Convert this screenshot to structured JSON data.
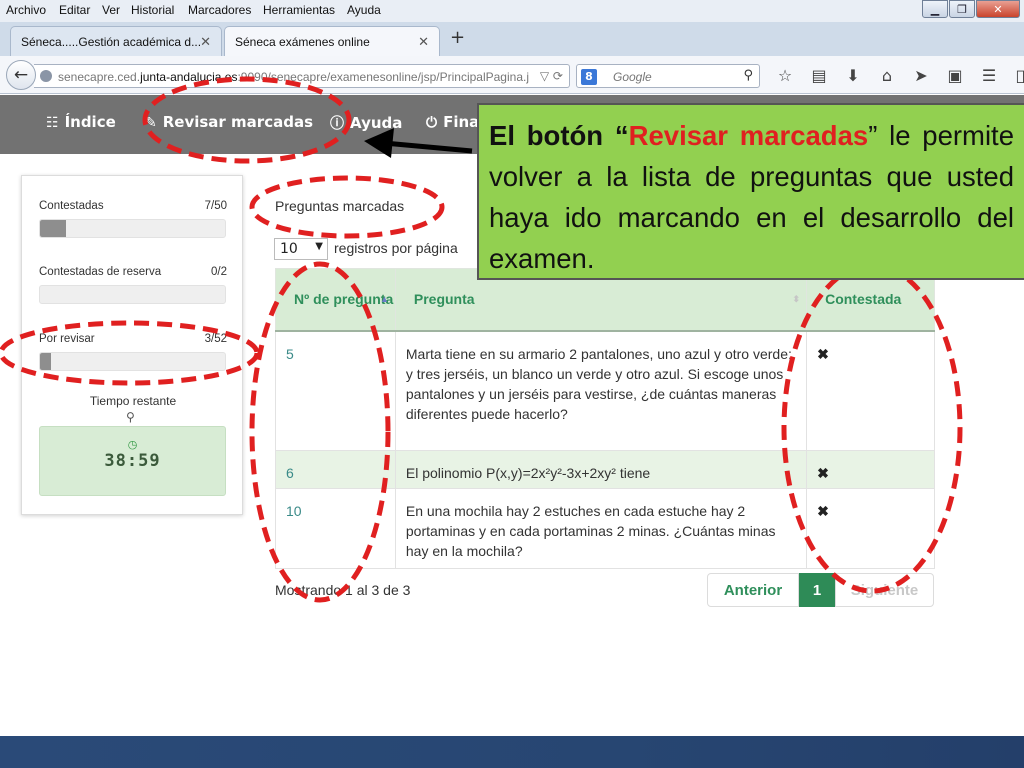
{
  "browser": {
    "menu": [
      "Archivo",
      "Editar",
      "Ver",
      "Historial",
      "Marcadores",
      "Herramientas",
      "Ayuda"
    ],
    "tabs": [
      {
        "label": "Séneca.....Gestión académica d..."
      },
      {
        "label": "Séneca exámenes online"
      }
    ],
    "url_pre": "senecapre.ced.",
    "url_host": "junta-andalucia.es",
    "url_post": ":9090/senecapre/examenesonline/jsp/PrincipalPagina.j",
    "search_placeholder": "Google"
  },
  "appnav": {
    "indice": "Índice",
    "revisar": "Revisar marcadas",
    "ayuda": "Ayuda",
    "finalizar": "Fina"
  },
  "sidebar": {
    "contestadas_label": "Contestadas",
    "contestadas_value": "7/50",
    "contestadas_fraction": 0.14,
    "reserva_label": "Contestadas de reserva",
    "reserva_value": "0/2",
    "reserva_fraction": 0,
    "revisar_label": "Por revisar",
    "revisar_value": "3/52",
    "revisar_fraction": 0.058,
    "tiempo_label": "Tiempo restante",
    "tiempo_value": "38:59"
  },
  "main": {
    "title": "Preguntas marcadas",
    "page_size": "10",
    "per_page_label": "registros por página",
    "columns": [
      "Nº de pregunta",
      "Pregunta",
      "Contestada"
    ],
    "rows": [
      {
        "num": "5",
        "text": "Marta tiene en su armario 2 pantalones, uno azul y otro verde; y tres jerséis, un blanco un verde y otro azul. Si escoge unos pantalones y un jerséis para vestirse, ¿de cuántas maneras diferentes puede hacerlo?",
        "answered": "✖"
      },
      {
        "num": "6",
        "text": "El polinomio P(x,y)=2x²y²-3x+2xy² tiene",
        "answered": "✖"
      },
      {
        "num": "10",
        "text": "En una mochila hay 2 estuches en cada estuche hay 2 portaminas y en cada portaminas 2 minas. ¿Cuántas minas hay en la mochila?",
        "answered": "✖"
      }
    ],
    "showing": "Mostrando 1 al 3 de 3",
    "pager": {
      "prev": "Anterior",
      "current": "1",
      "next": "Siguiente"
    }
  },
  "callout": {
    "p1": "El botón “",
    "highlight": "Revisar marcadas",
    "p2": "” le permite volver a la lista de preguntas que usted haya ido marcando en el desarrollo del examen."
  },
  "colors": {
    "callout_bg": "#92d050",
    "annotation_red": "#e02020",
    "table_header_bg": "#d8ecd5",
    "accent_green": "#2e8b57"
  }
}
